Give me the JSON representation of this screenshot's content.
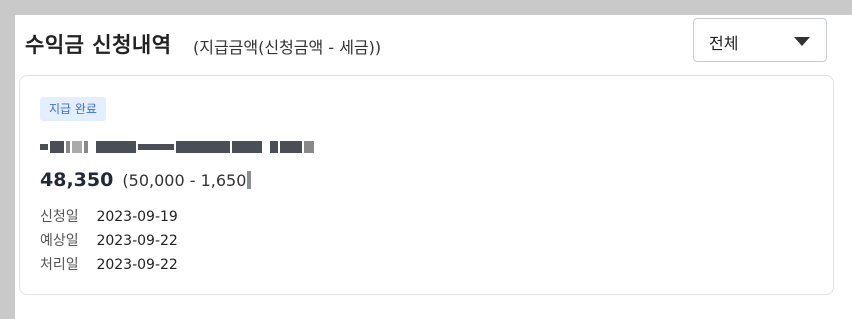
{
  "header": {
    "title": "수익금 신청내역",
    "subtitle": "(지급금액(신청금액 - 세금))"
  },
  "filter": {
    "selected": "전체"
  },
  "items": [
    {
      "status": "지급 완료",
      "net_amount": "48,350",
      "breakdown": "(50,000 - 1,650",
      "dates": [
        {
          "label": "신청일",
          "value": "2023-09-19"
        },
        {
          "label": "예상일",
          "value": "2023-09-22"
        },
        {
          "label": "처리일",
          "value": "2023-09-22"
        }
      ]
    }
  ],
  "colors": {
    "badge_bg": "#e3efff",
    "badge_text": "#3a70d6"
  }
}
